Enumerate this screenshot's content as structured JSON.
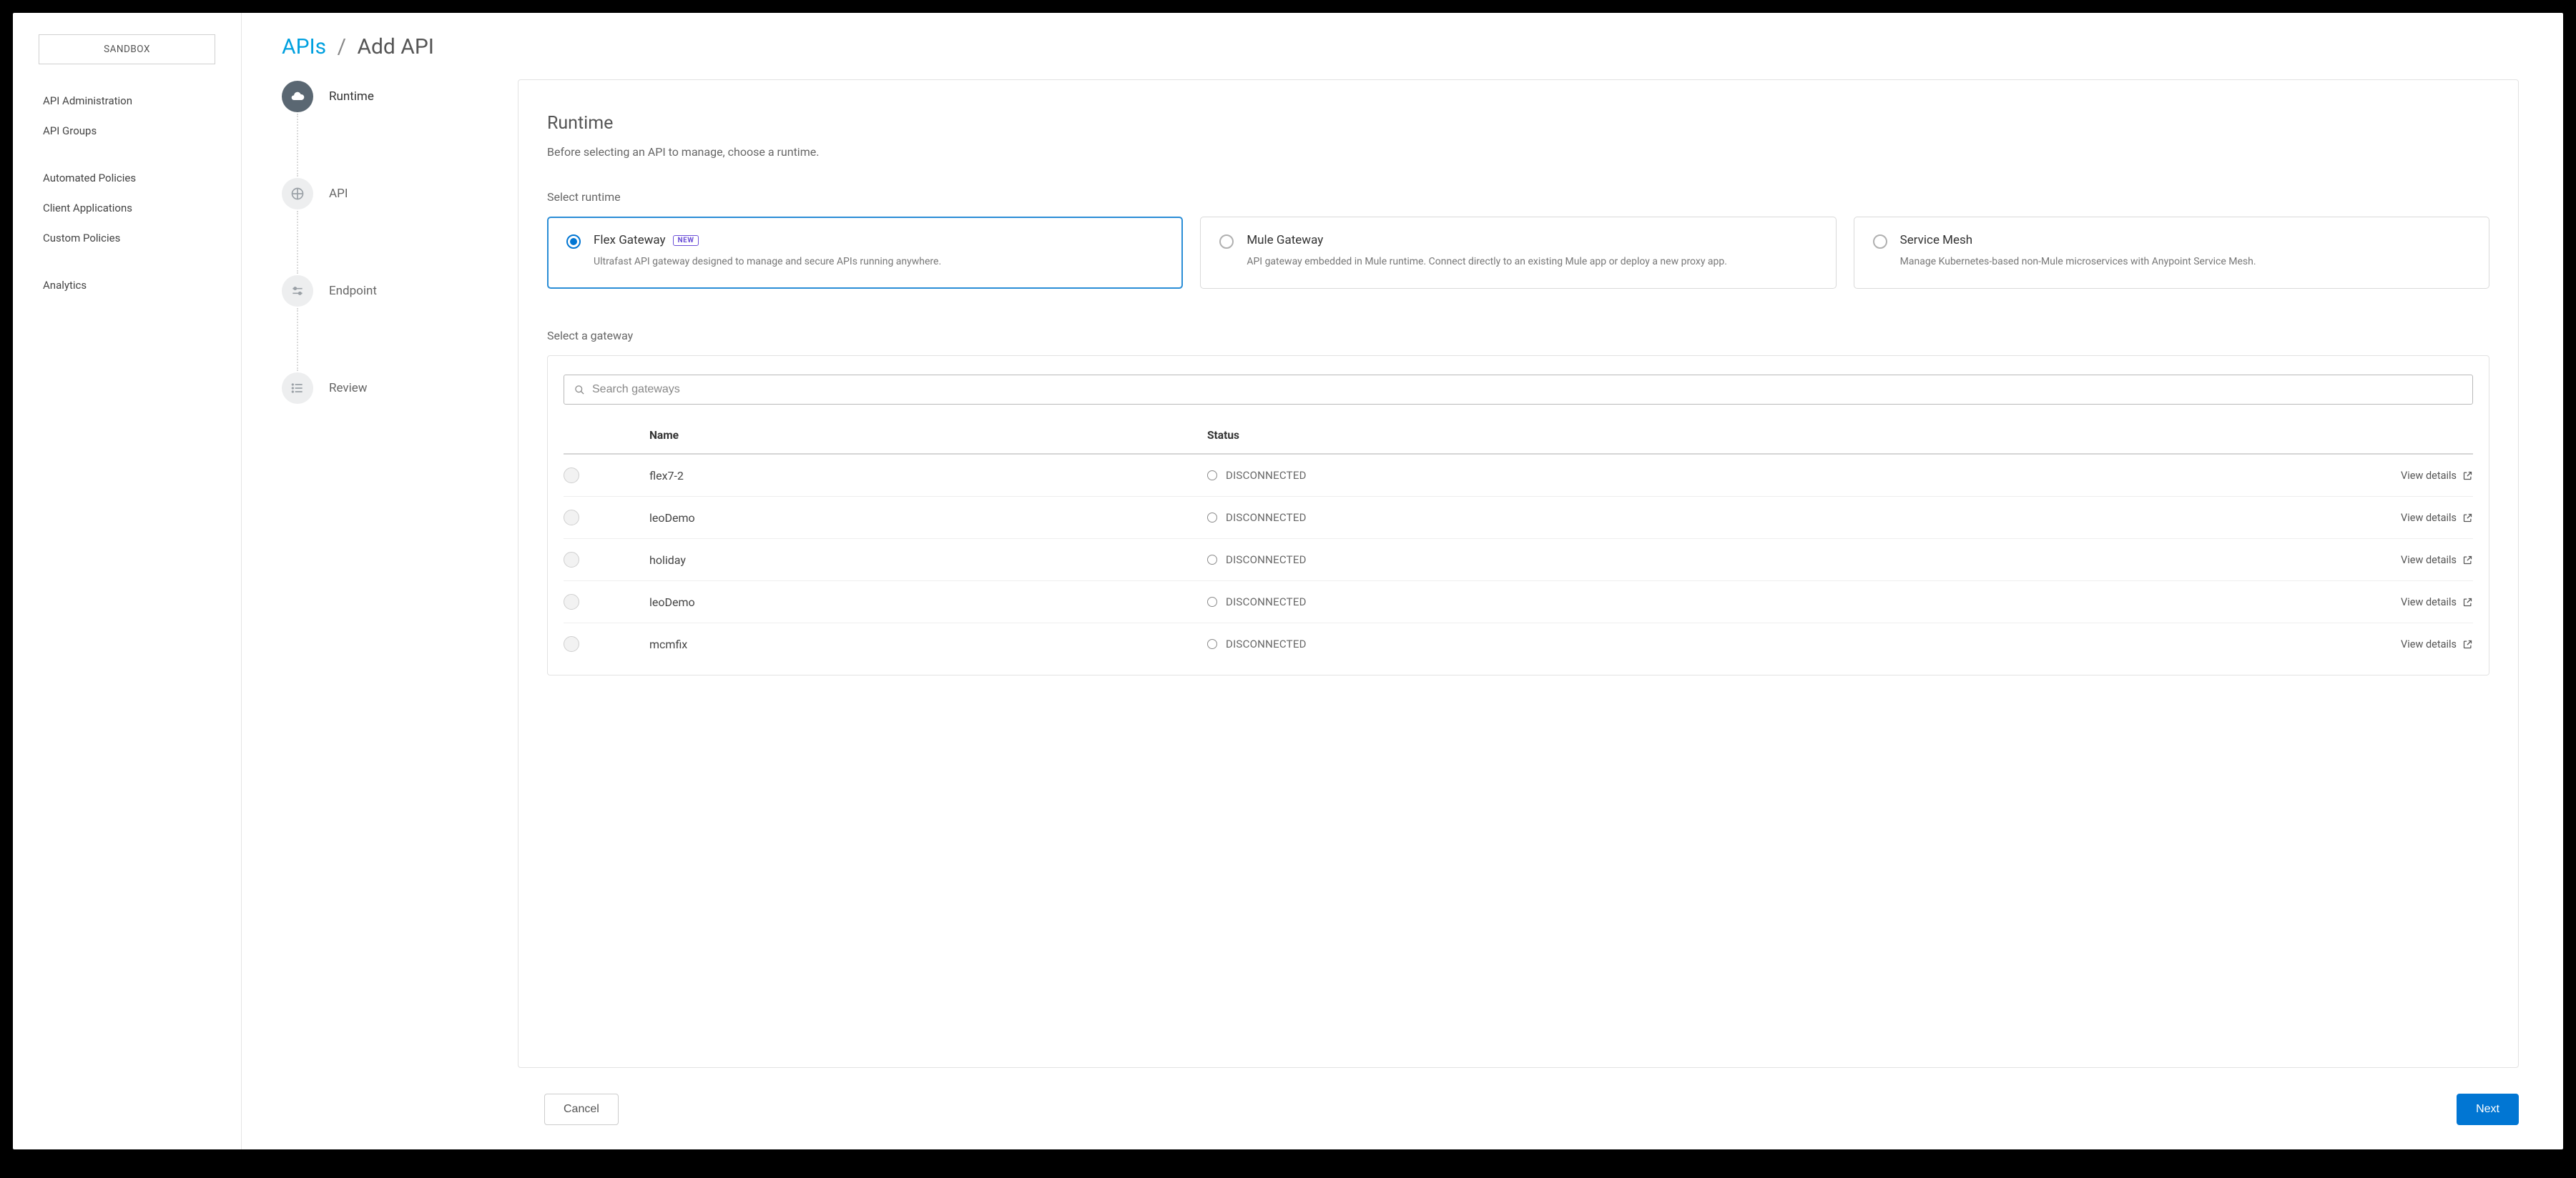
{
  "sidebar": {
    "env": "SANDBOX",
    "groups": [
      {
        "items": [
          "API Administration",
          "API Groups"
        ]
      },
      {
        "items": [
          "Automated Policies",
          "Client Applications",
          "Custom Policies"
        ]
      },
      {
        "items": [
          "Analytics"
        ]
      }
    ]
  },
  "breadcrumb": {
    "root": "APIs",
    "sep": "/",
    "leaf": "Add API"
  },
  "stepper": [
    {
      "label": "Runtime",
      "active": true
    },
    {
      "label": "API",
      "active": false
    },
    {
      "label": "Endpoint",
      "active": false
    },
    {
      "label": "Review",
      "active": false
    }
  ],
  "panel": {
    "title": "Runtime",
    "subtitle": "Before selecting an API to manage, choose a runtime.",
    "select_runtime_label": "Select runtime",
    "cards": [
      {
        "title": "Flex Gateway",
        "badge": "NEW",
        "desc": "Ultrafast API gateway designed to manage and secure APIs running anywhere.",
        "selected": true
      },
      {
        "title": "Mule Gateway",
        "badge": null,
        "desc": "API gateway embedded in Mule runtime. Connect directly to an existing Mule app or deploy a new proxy app.",
        "selected": false
      },
      {
        "title": "Service Mesh",
        "badge": null,
        "desc": "Manage Kubernetes-based non-Mule microservices with Anypoint Service Mesh.",
        "selected": false
      }
    ],
    "select_gateway_label": "Select a gateway",
    "search_placeholder": "Search gateways",
    "table": {
      "headers": {
        "name": "Name",
        "status": "Status"
      },
      "rows": [
        {
          "name": "flex7-2",
          "status": "DISCONNECTED",
          "action": "View details"
        },
        {
          "name": "leoDemo",
          "status": "DISCONNECTED",
          "action": "View details"
        },
        {
          "name": "holiday",
          "status": "DISCONNECTED",
          "action": "View details"
        },
        {
          "name": "leoDemo",
          "status": "DISCONNECTED",
          "action": "View details"
        },
        {
          "name": "mcmfix",
          "status": "DISCONNECTED",
          "action": "View details"
        }
      ]
    }
  },
  "footer": {
    "cancel": "Cancel",
    "next": "Next"
  }
}
